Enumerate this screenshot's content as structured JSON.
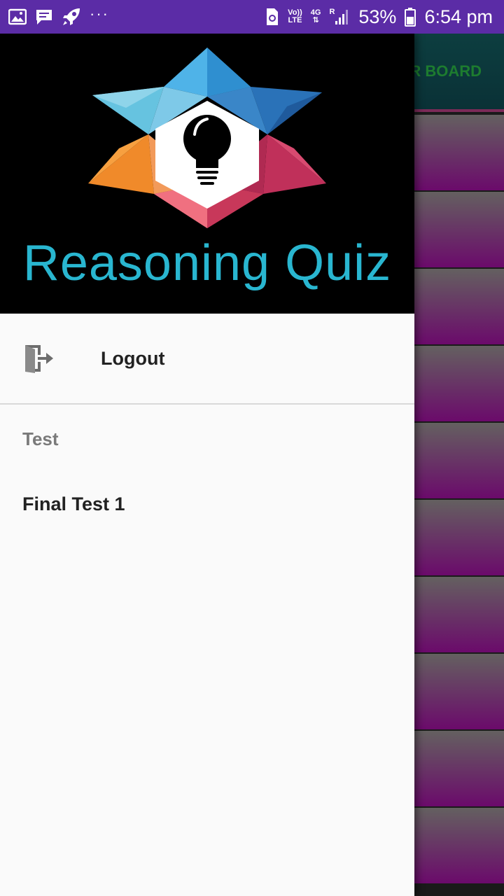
{
  "status_bar": {
    "icons_left": [
      "image-icon",
      "chat-icon",
      "rocket-icon"
    ],
    "more": "···",
    "volte_top": "Vo))",
    "volte_bottom": "LTE",
    "network_top": "4G",
    "network_bottom": "⇅",
    "roaming": "R",
    "battery_percent": "53%",
    "time": "6:54 pm"
  },
  "background": {
    "header_text": "R BOARD",
    "tile_count_visible": 10
  },
  "drawer": {
    "app_title": "Reasoning Quiz",
    "logout_label": "Logout",
    "section_title": "Test",
    "items": [
      {
        "label": "Final Test 1"
      }
    ]
  },
  "colors": {
    "status_bar": "#5b2ca6",
    "title": "#29b6d0",
    "drawer_bg": "#fafafa",
    "header_bg": "#000000"
  }
}
